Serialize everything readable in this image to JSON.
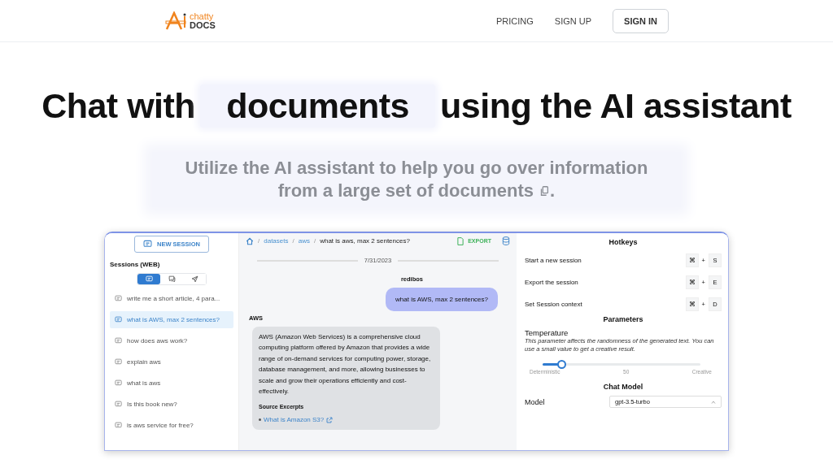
{
  "header": {
    "logo": {
      "top": "chatty",
      "bottom": "DOCS"
    },
    "nav": [
      {
        "kind": "link",
        "label": "PRICING"
      },
      {
        "kind": "link",
        "label": "SIGN UP"
      },
      {
        "kind": "button",
        "label": "SIGN IN"
      }
    ]
  },
  "hero": {
    "title_before": "Chat with",
    "title_highlight": "documents",
    "title_after": "using the AI assistant",
    "subtitle": "Utilize the AI assistant to help you go over information from a large set of documents",
    "subtitle_end": "."
  },
  "app_preview": {
    "sidebar": {
      "new_session": "NEW SESSION",
      "heading": "Sessions (WEB)",
      "view_tabs": [
        {
          "kind": "chat",
          "selected": true
        },
        {
          "kind": "comments",
          "selected": false
        },
        {
          "kind": "send",
          "selected": false
        }
      ],
      "sessions": [
        {
          "label": "write me a short article, 4 para...",
          "selected": false
        },
        {
          "label": "what is AWS, max 2 sentences?",
          "selected": true
        },
        {
          "label": "how does aws work?",
          "selected": false
        },
        {
          "label": "explain aws",
          "selected": false
        },
        {
          "label": "what is aws",
          "selected": false
        },
        {
          "label": "Is this book new?",
          "selected": false
        },
        {
          "label": "is aws service for free?",
          "selected": false
        }
      ]
    },
    "chat": {
      "breadcrumb": [
        "datasets",
        "aws"
      ],
      "separator": "/",
      "current": "what is aws, max 2 sentences?",
      "export": "EXPORT",
      "date": "7/31/2023",
      "messages": [
        {
          "kind": "user",
          "author": "redibos",
          "text": "what is AWS, max 2 sentences?"
        },
        {
          "kind": "assistant",
          "author": "AWS",
          "text": "AWS (Amazon Web Services) is a comprehensive cloud computing platform offered by Amazon that provides a wide range of on-demand services for computing power, storage, database management, and more, allowing businesses to scale and grow their operations efficiently and cost-effectively.",
          "sources_heading": "Source Excerpts",
          "sources": [
            "What is Amazon S3?"
          ]
        }
      ]
    },
    "settings": {
      "hotkeys_title": "Hotkeys",
      "hotkeys": [
        {
          "label": "Start a new session",
          "modifier": "⌘",
          "plus": "+",
          "key": "S"
        },
        {
          "label": "Export the session",
          "modifier": "⌘",
          "plus": "+",
          "key": "E"
        },
        {
          "label": "Set Session context",
          "modifier": "⌘",
          "plus": "+",
          "key": "D"
        }
      ],
      "parameters_title": "Parameters",
      "temperature": {
        "label": "Temperature",
        "description": "This parameter affects the randomness of the generated text. You can use a small value to get a creative result.",
        "level": 0.12,
        "scale": [
          "Deterministic",
          "50",
          "Creative"
        ]
      },
      "chat_model_title": "Chat Model",
      "model": {
        "label": "Model",
        "value": "gpt-3.5-turbo"
      }
    }
  }
}
